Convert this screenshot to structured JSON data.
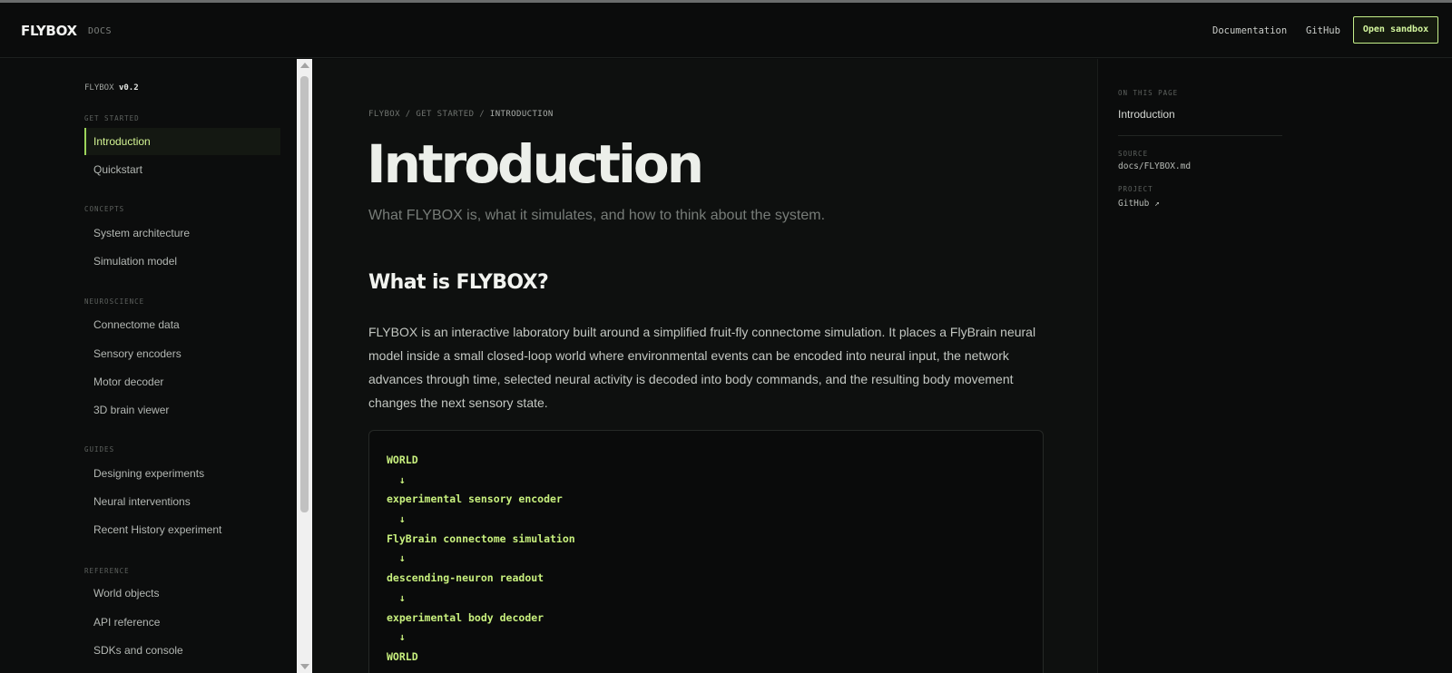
{
  "header": {
    "brand": "FLYBOX",
    "brand_sub": "DOCS",
    "nav_docs": "Documentation",
    "nav_github": "GitHub",
    "sandbox": "Open sandbox"
  },
  "sidebar": {
    "version_name": "FLYBOX",
    "version_num": "v0.2",
    "sections": {
      "get_started": "GET STARTED",
      "concepts": "CONCEPTS",
      "neuroscience": "NEUROSCIENCE",
      "guides": "GUIDES",
      "reference": "REFERENCE"
    },
    "items": {
      "introduction": "Introduction",
      "quickstart": "Quickstart",
      "system_architecture": "System architecture",
      "simulation_model": "Simulation model",
      "connectome_data": "Connectome data",
      "sensory_encoders": "Sensory encoders",
      "motor_decoder": "Motor decoder",
      "brain_viewer": "3D brain viewer",
      "designing_experiments": "Designing experiments",
      "neural_interventions": "Neural interventions",
      "recent_history": "Recent History experiment",
      "world_objects": "World objects",
      "api_reference": "API reference",
      "sdks_console": "SDKs and console"
    }
  },
  "main": {
    "breadcrumb": [
      "FLYBOX",
      "/",
      "GET STARTED",
      "/",
      "INTRODUCTION"
    ],
    "title": "Introduction",
    "subtitle": "What FLYBOX is, what it simulates, and how to think about the system.",
    "section_title": "What is FLYBOX?",
    "paragraph": "FLYBOX is an interactive laboratory built around a simplified fruit-fly connectome simulation. It places a FlyBrain neural model inside a small closed-loop world where environmental events can be encoded into neural input, the network advances through time, selected neural activity is decoded into body commands, and the resulting body movement changes the next sensory state.",
    "code_lines": [
      "WORLD",
      "  ↓",
      "experimental sensory encoder",
      "  ↓",
      "FlyBrain connectome simulation",
      "  ↓",
      "descending-neuron readout",
      "  ↓",
      "experimental body decoder",
      "  ↓",
      "WORLD"
    ]
  },
  "toc": {
    "on_this_page": "ON THIS PAGE",
    "item": "Introduction",
    "source_label": "SOURCE",
    "source_value": "docs/FLYBOX.md",
    "project_label": "PROJECT",
    "project_value": "GitHub ↗"
  },
  "colors": {
    "accent": "#c6f08a",
    "background": "#0b0c0c",
    "code_text": "#c8f07e"
  }
}
